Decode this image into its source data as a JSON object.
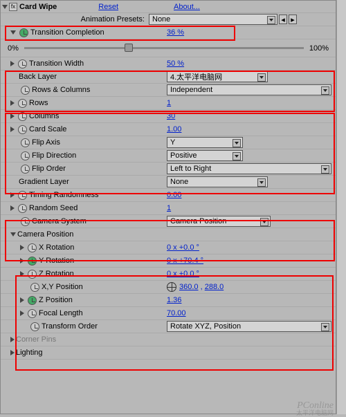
{
  "effect": {
    "name": "Card Wipe",
    "reset": "Reset",
    "about": "About..."
  },
  "presets": {
    "label": "Animation Presets:",
    "value": "None"
  },
  "props": {
    "transition_completion": {
      "label": "Transition Completion",
      "value": "36 %"
    },
    "transition_width": {
      "label": "Transition Width",
      "value": "50 %"
    },
    "back_layer": {
      "label": "Back Layer",
      "value": "4.太平洋电脑网"
    },
    "rows_columns": {
      "label": "Rows & Columns",
      "value": "Independent"
    },
    "rows": {
      "label": "Rows",
      "value": "1"
    },
    "columns": {
      "label": "Columns",
      "value": "30"
    },
    "card_scale": {
      "label": "Card Scale",
      "value": "1.00"
    },
    "flip_axis": {
      "label": "Flip Axis",
      "value": "Y"
    },
    "flip_direction": {
      "label": "Flip Direction",
      "value": "Positive"
    },
    "flip_order": {
      "label": "Flip Order",
      "value": "Left to Right"
    },
    "gradient_layer": {
      "label": "Gradient Layer",
      "value": "None"
    },
    "timing_randomness": {
      "label": "Timing Randomness",
      "value": "0.00"
    },
    "random_seed": {
      "label": "Random Seed",
      "value": "1"
    },
    "camera_system": {
      "label": "Camera System",
      "value": "Camera Position"
    },
    "camera_position_group": {
      "label": "Camera Position"
    },
    "x_rotation": {
      "label": "X Rotation",
      "value": "0 x +0.0 °"
    },
    "y_rotation": {
      "label": "Y Rotation",
      "value": "0 x +70.4 °"
    },
    "z_rotation": {
      "label": "Z Rotation",
      "value": "0 x +0.0 °"
    },
    "xy_position": {
      "label": "X,Y Position",
      "x": "360.0",
      "y": "288.0"
    },
    "z_position": {
      "label": "Z Position",
      "value": "1.36"
    },
    "focal_length": {
      "label": "Focal Length",
      "value": "70.00"
    },
    "transform_order": {
      "label": "Transform Order",
      "value": "Rotate XYZ, Position"
    },
    "corner_pins": {
      "label": "Corner Pins"
    },
    "lighting": {
      "label": "Lighting"
    }
  },
  "slider": {
    "min": "0%",
    "max": "100%",
    "pos_pct": 36
  },
  "watermark": "PConline",
  "watermark_cn": "太平洋电脑网"
}
